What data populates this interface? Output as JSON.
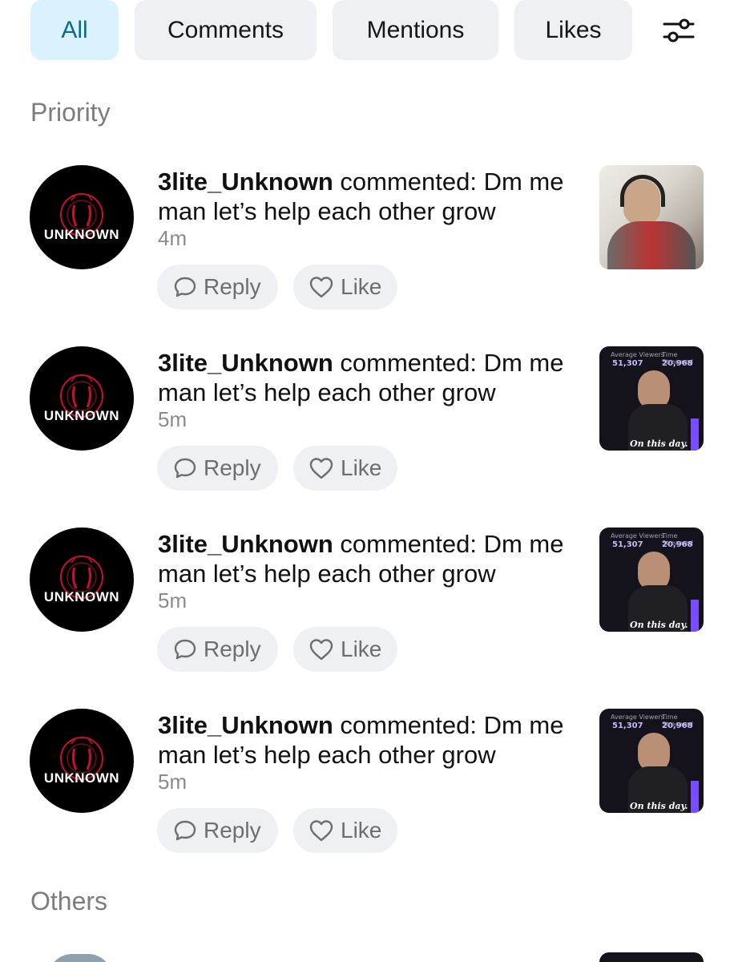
{
  "tabs": [
    {
      "label": "All",
      "active": true
    },
    {
      "label": "Comments",
      "active": false
    },
    {
      "label": "Mentions",
      "active": false
    },
    {
      "label": "Likes",
      "active": false
    }
  ],
  "filter_icon": "sliders-icon",
  "sections": {
    "priority": "Priority",
    "others": "Others"
  },
  "notifications": [
    {
      "username": "3lite_Unknown",
      "action": "commented:",
      "comment": "Dm me man let’s help each other grow",
      "time": "4m",
      "avatar_label": "UNKNOWN",
      "reply_label": "Reply",
      "like_label": "Like",
      "thumbnail": "photo"
    },
    {
      "username": "3lite_Unknown",
      "action": "commented:",
      "comment": "Dm me man let’s help each other grow",
      "time": "5m",
      "avatar_label": "UNKNOWN",
      "reply_label": "Reply",
      "like_label": "Like",
      "thumbnail": "stats"
    },
    {
      "username": "3lite_Unknown",
      "action": "commented:",
      "comment": "Dm me man let’s help each other grow",
      "time": "5m",
      "avatar_label": "UNKNOWN",
      "reply_label": "Reply",
      "like_label": "Like",
      "thumbnail": "stats"
    },
    {
      "username": "3lite_Unknown",
      "action": "commented:",
      "comment": "Dm me man let’s help each other grow",
      "time": "5m",
      "avatar_label": "UNKNOWN",
      "reply_label": "Reply",
      "like_label": "Like",
      "thumbnail": "stats"
    }
  ],
  "thumbnail_stats": {
    "left_heading": "Average Viewers",
    "right_heading": "Time Streamed",
    "left_value": "51,307",
    "right_value": "20,968",
    "caption": "On this day."
  },
  "colors": {
    "active_tab_bg": "#d9f2fb",
    "active_tab_text": "#0c6a94",
    "pill_bg": "#eff0f3",
    "avatar_accent": "#c8102e"
  }
}
